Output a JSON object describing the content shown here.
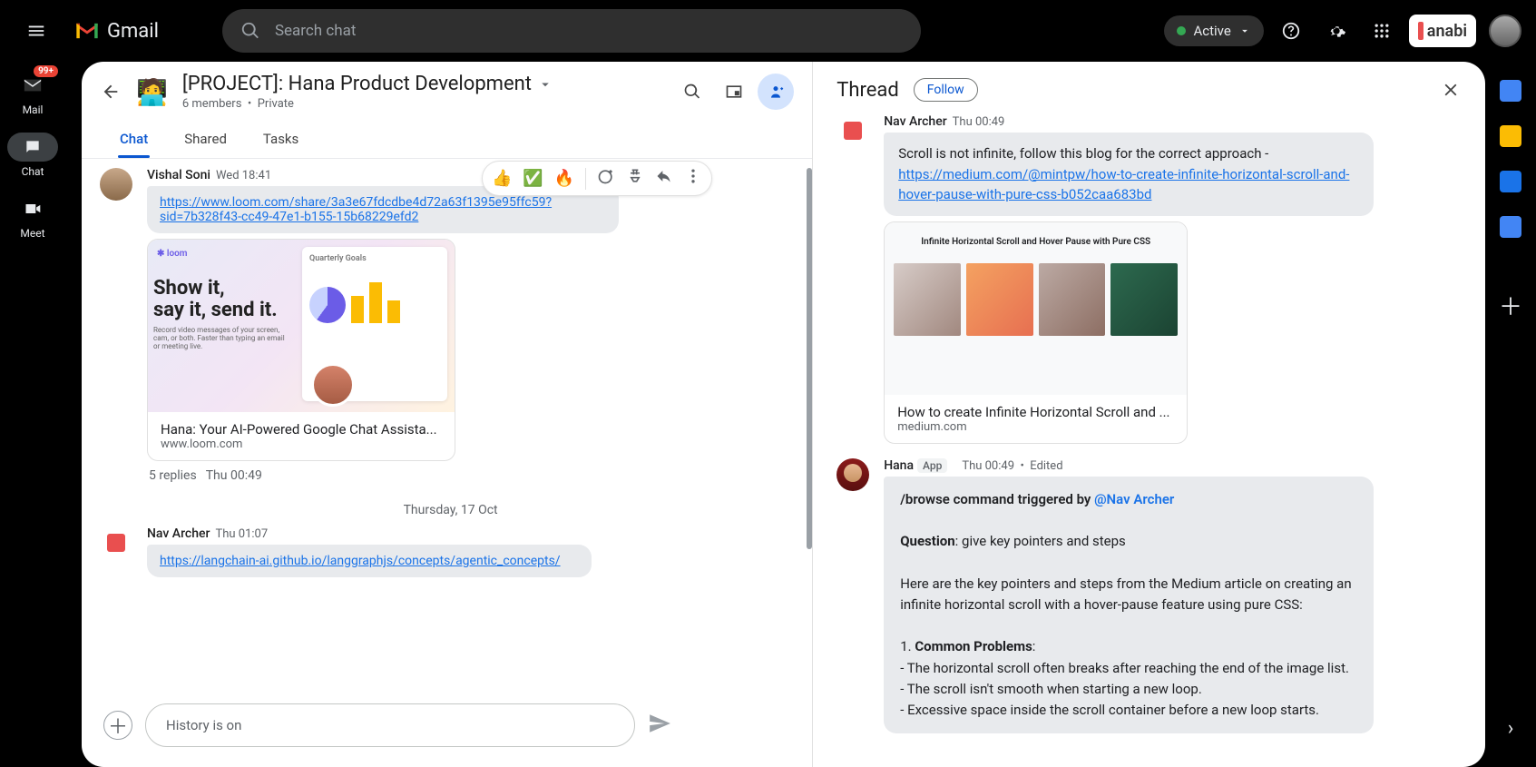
{
  "brand": "Gmail",
  "search_placeholder": "Search chat",
  "status_label": "Active",
  "org_name": "anabi",
  "nav": {
    "mail": "Mail",
    "mail_badge": "99+",
    "chat": "Chat",
    "meet": "Meet"
  },
  "space": {
    "title": "[PROJECT]: Hana Product Development",
    "members": "6 members",
    "privacy": "Private"
  },
  "tabs": {
    "chat": "Chat",
    "shared": "Shared",
    "tasks": "Tasks"
  },
  "reactions": {
    "r1": "👍",
    "r2": "✅",
    "r3": "🔥"
  },
  "msg1": {
    "author": "Vishal Soni",
    "time": "Wed 18:41",
    "link": "https://www.loom.com/share/3a3e67fdcdbe4d72a63f1395e95ffc59?sid=7b328f43-cc49-47e1-b155-15b68229efd2",
    "preview_title": "Hana: Your AI-Powered Google Chat Assista...",
    "preview_domain": "www.loom.com",
    "preview_img_title1": "Show it,\nsay it, send it.",
    "preview_badge": "Quarterly Goals",
    "replies_count": "5 replies",
    "replies_time": "Thu 00:49"
  },
  "date_sep": "Thursday, 17 Oct",
  "msg2": {
    "author": "Nav Archer",
    "time": "Thu 01:07",
    "link": "https://langchain-ai.github.io/langgraphjs/concepts/agentic_concepts/"
  },
  "composer_text": "History is on",
  "thread": {
    "title": "Thread",
    "follow": "Follow",
    "m1": {
      "author": "Nav Archer",
      "time": "Thu 00:49",
      "text_prefix": "Scroll is not infinite, follow this blog for the correct approach - ",
      "link": "https://medium.com/@mintpw/how-to-create-infinite-horizontal-scroll-and-hover-pause-with-pure-css-b052caa683bd",
      "prev_img_title": "Infinite Horizontal Scroll and Hover Pause with Pure CSS",
      "prev_title": "How to create Infinite Horizontal Scroll and ...",
      "prev_domain": "medium.com"
    },
    "m2": {
      "author": "Hana",
      "app_chip": "App",
      "time": "Thu 00:49",
      "edited": "Edited",
      "line1a": "/browse command triggered by ",
      "mention": "@Nav Archer",
      "q_label": "Question",
      "q_text": ": give key pointers and steps",
      "para1": "Here are the key pointers and steps from the Medium article on creating an infinite horizontal scroll with a hover-pause feature using pure CSS:",
      "h1_num": "1. ",
      "h1": "Common Problems",
      "b1": "   - The horizontal scroll often breaks after reaching the end of the image list.",
      "b2": "   - The scroll isn't smooth when starting a new loop.",
      "b3": "   - Excessive space inside the scroll container before a new loop starts."
    }
  }
}
